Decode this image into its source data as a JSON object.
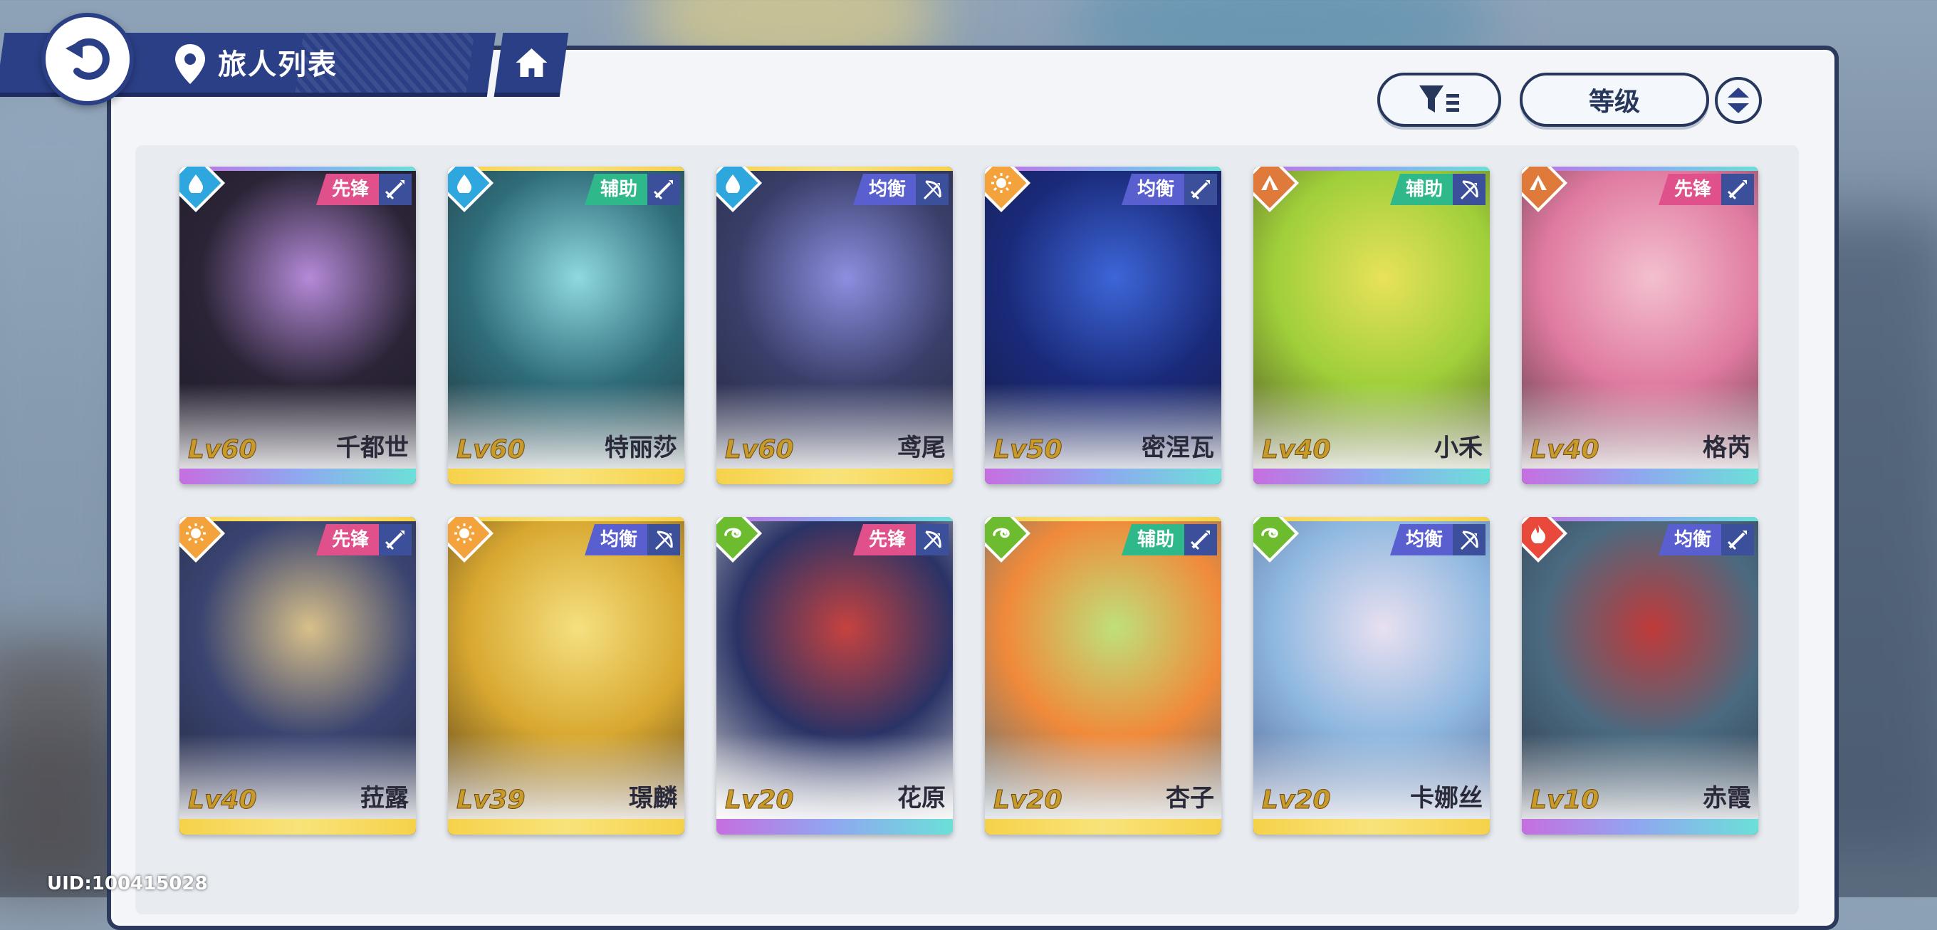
{
  "header": {
    "title": "旅人列表"
  },
  "controls": {
    "sort_label": "等级"
  },
  "uid": "UID:100415028",
  "colors": {
    "hydro": "#2ea6de",
    "solar": "#f3a23c",
    "terra": "#e07a3a",
    "wind": "#6dbb2e",
    "pyro": "#e8493a",
    "role_vanguard": "#e0508a",
    "role_support": "#2fb98a",
    "role_balanced": "#5a5fd0"
  },
  "characters": [
    {
      "name": "千都世",
      "level": "Lv60",
      "role": "先锋",
      "element": "hydro-icon",
      "weapon": "sword-icon",
      "rarity": "purple"
    },
    {
      "name": "特丽莎",
      "level": "Lv60",
      "role": "辅助",
      "element": "hydro-icon",
      "weapon": "sword-icon",
      "rarity": "gold"
    },
    {
      "name": "鸢尾",
      "level": "Lv60",
      "role": "均衡",
      "element": "hydro-icon",
      "weapon": "bow-icon",
      "rarity": "gold"
    },
    {
      "name": "密涅瓦",
      "level": "Lv50",
      "role": "均衡",
      "element": "solar-icon",
      "weapon": "sword-icon",
      "rarity": "purple"
    },
    {
      "name": "小禾",
      "level": "Lv40",
      "role": "辅助",
      "element": "terra-icon",
      "weapon": "bow-icon",
      "rarity": "purple"
    },
    {
      "name": "格芮",
      "level": "Lv40",
      "role": "先锋",
      "element": "terra-icon",
      "weapon": "sword-icon",
      "rarity": "purple"
    },
    {
      "name": "菈露",
      "level": "Lv40",
      "role": "先锋",
      "element": "solar-icon",
      "weapon": "sword-icon",
      "rarity": "gold"
    },
    {
      "name": "璟麟",
      "level": "Lv39",
      "role": "均衡",
      "element": "solar-icon",
      "weapon": "bow-icon",
      "rarity": "gold"
    },
    {
      "name": "花原",
      "level": "Lv20",
      "role": "先锋",
      "element": "wind-icon",
      "weapon": "bow-icon",
      "rarity": "purple"
    },
    {
      "name": "杏子",
      "level": "Lv20",
      "role": "辅助",
      "element": "wind-icon",
      "weapon": "sword-icon",
      "rarity": "gold"
    },
    {
      "name": "卡娜丝",
      "level": "Lv20",
      "role": "均衡",
      "element": "wind-icon",
      "weapon": "bow-icon",
      "rarity": "gold"
    },
    {
      "name": "赤霞",
      "level": "Lv10",
      "role": "均衡",
      "element": "pyro-icon",
      "weapon": "sword-icon",
      "rarity": "purple"
    }
  ]
}
